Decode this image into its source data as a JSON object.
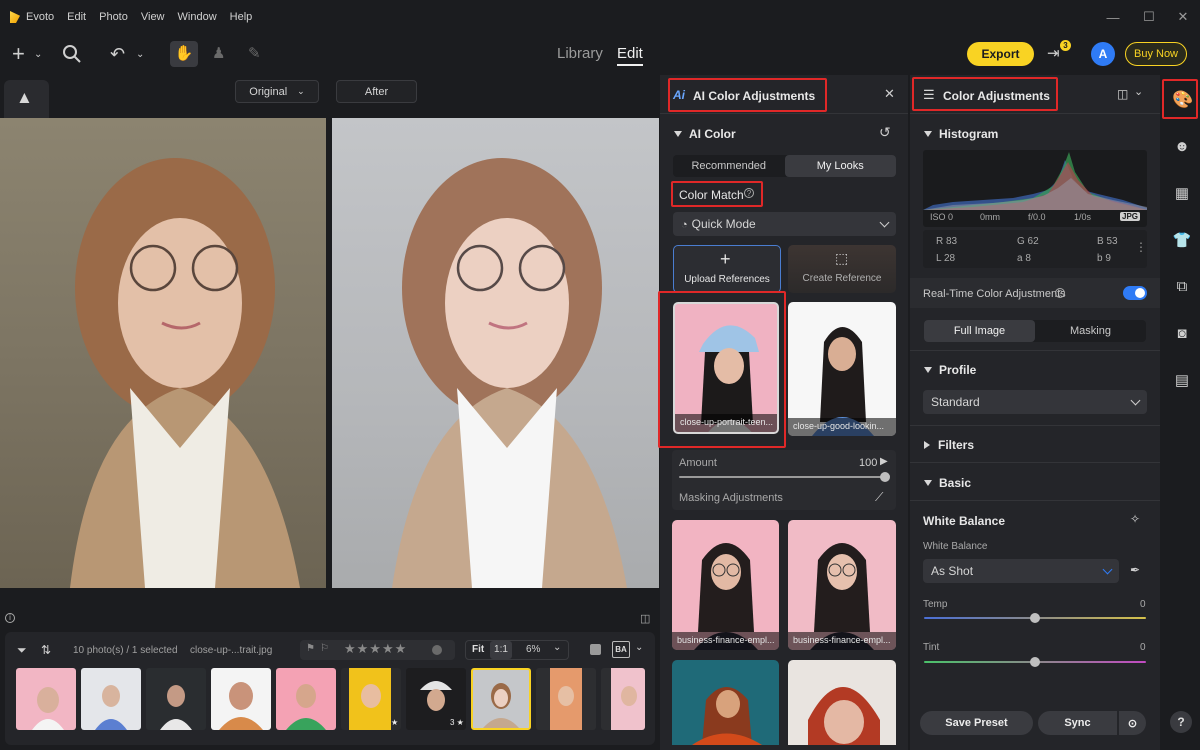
{
  "app": {
    "name": "Evoto",
    "menu": [
      "Edit",
      "Photo",
      "View",
      "Window",
      "Help"
    ]
  },
  "toolbar": {
    "mode_library": "Library",
    "mode_edit": "Edit",
    "export_label": "Export",
    "notif_count": "3",
    "avatar_initial": "A",
    "buy_label": "Buy Now"
  },
  "canvas": {
    "original_label": "Original",
    "after_label": "After"
  },
  "filmstrip": {
    "count_text": "10 photo(s) / 1 selected",
    "filename": "close-up-...trait.jpg",
    "fit_label": "Fit",
    "ratio_label": "1:1",
    "zoom": "6%",
    "badge_label": "BA",
    "stars_count": 5,
    "thumb_stars": [
      "",
      "",
      "",
      "",
      "",
      "★",
      "3 ★",
      "",
      "",
      ""
    ]
  },
  "ai_panel": {
    "title": "AI Color Adjustments",
    "section": "AI Color",
    "tabs": [
      "Recommended",
      "My Looks"
    ],
    "active_tab": 1,
    "color_match": "Color Match",
    "mode": "Quick Mode",
    "upload_label": "Upload References",
    "create_label": "Create Reference",
    "looks": [
      {
        "label": "close-up-portrait-teen..."
      },
      {
        "label": "close-up-good-lookin..."
      },
      {
        "label": "business-finance-empl..."
      },
      {
        "label": "business-finance-empl..."
      }
    ],
    "amount_label": "Amount",
    "amount_value": "100",
    "masking_label": "Masking Adjustments"
  },
  "color_panel": {
    "title": "Color Adjustments",
    "histogram_title": "Histogram",
    "meta": [
      "ISO 0",
      "0mm",
      "f/0.0",
      "1/0s",
      "JPG"
    ],
    "rgb": {
      "r": "R 83",
      "g": "G 62",
      "b": "B 53",
      "l": "L 28",
      "a": "a 8",
      "b2": "b 9"
    },
    "realtime_label": "Real-Time Color Adjustments",
    "realtime_on": true,
    "tabs": [
      "Full Image",
      "Masking"
    ],
    "active_tab": 0,
    "profile_title": "Profile",
    "profile_value": "Standard",
    "filters_title": "Filters",
    "basic_title": "Basic",
    "wb_title": "White Balance",
    "wb_sub": "White Balance",
    "wb_value": "As Shot",
    "temp_label": "Temp",
    "temp_value": "0",
    "tint_label": "Tint",
    "tint_value": "0",
    "save_preset": "Save Preset",
    "sync": "Sync"
  },
  "colors": {
    "accent_yellow": "#f9d323",
    "accent_blue": "#2f7bf5",
    "highlight_red": "#e02828"
  }
}
